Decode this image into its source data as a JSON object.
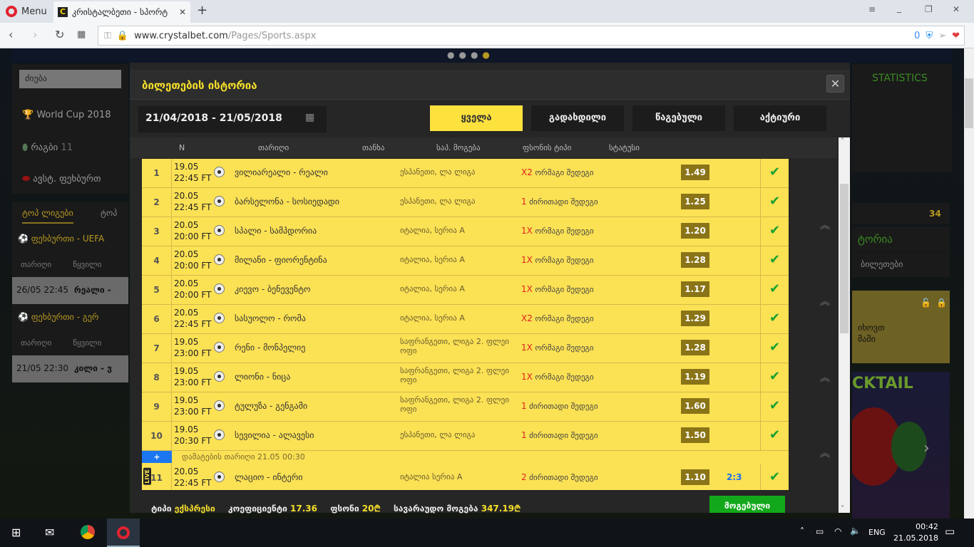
{
  "browser": {
    "menu": "Menu",
    "tab_title": "კრისტალბეთი - სპორტ",
    "new_tab": "+",
    "url_domain": "www.crystalbet.com",
    "url_path": "/Pages/Sports.aspx",
    "blocked_count": "0"
  },
  "background": {
    "search_placeholder": "ძიება",
    "sports": [
      {
        "label": "World Cup 2018",
        "count": ""
      },
      {
        "label": "რაგბი",
        "count": "11"
      },
      {
        "label": "ავსტ. ფეხბურთ",
        "count": ""
      }
    ],
    "tabs": [
      "ტოპ ლიგები",
      "ტოპ"
    ],
    "leagues": [
      {
        "title": "ფეხბურთი - UEFA",
        "col_date": "თარიღი",
        "col_match": "წყვილი",
        "date": "26/05 22:45",
        "match": "რეალი - "
      },
      {
        "title": "ფეხბურთი - გერ",
        "col_date": "თარიღი",
        "col_match": "წყვილი",
        "date": "21/05 22:30",
        "match": "კილი - ვ"
      }
    ],
    "statistics": "STATISTICS",
    "count": "34",
    "history": "ტორია",
    "tickets": "ბილეთები",
    "promo": [
      "იხოვთ",
      "მაში"
    ],
    "banner": "CKTAIL"
  },
  "modal": {
    "title": "ბილეთების ისტორია",
    "close": "✕",
    "date_range": "21/04/2018 - 21/05/2018",
    "filters": [
      "ყველა",
      "გადახდილი",
      "წაგებული",
      "აქტიური"
    ],
    "columns": [
      "N",
      "თარიღი",
      "თანხა",
      "საპ. მოგება",
      "ფსონის ტიპი",
      "სტატუსი"
    ],
    "rows": [
      {
        "n": "1",
        "date": "19.05",
        "time": "22:45 FT",
        "match": "ვილიარეალი - რეალი",
        "league": "ესპანეთი, ლა ლიგა",
        "pick": "X2",
        "bet": "ორმაგი შედეგი",
        "odds": "1.49",
        "score": "",
        "status": "✔"
      },
      {
        "n": "2",
        "date": "20.05",
        "time": "22:45 FT",
        "match": "ბარსელონა - სოსიედადი",
        "league": "ესპანეთი, ლა ლიგა",
        "pick": "1",
        "bet": "ძირითადი შედეგი",
        "odds": "1.25",
        "score": "",
        "status": "✔"
      },
      {
        "n": "3",
        "date": "20.05",
        "time": "20:00 FT",
        "match": "სპალი - სამპდორია",
        "league": "იტალია, სერია A",
        "pick": "1X",
        "bet": "ორმაგი შედეგი",
        "odds": "1.20",
        "score": "",
        "status": "✔"
      },
      {
        "n": "4",
        "date": "20.05",
        "time": "20:00 FT",
        "match": "მილანი - ფიორენტინა",
        "league": "იტალია, სერია A",
        "pick": "1X",
        "bet": "ორმაგი შედეგი",
        "odds": "1.28",
        "score": "",
        "status": "✔"
      },
      {
        "n": "5",
        "date": "20.05",
        "time": "20:00 FT",
        "match": "კიევო - ბენევენტო",
        "league": "იტალია, სერია A",
        "pick": "1X",
        "bet": "ორმაგი შედეგი",
        "odds": "1.17",
        "score": "",
        "status": "✔"
      },
      {
        "n": "6",
        "date": "20.05",
        "time": "22:45 FT",
        "match": "სასუოლო - რომა",
        "league": "იტალია, სერია A",
        "pick": "X2",
        "bet": "ორმაგი შედეგი",
        "odds": "1.29",
        "score": "",
        "status": "✔"
      },
      {
        "n": "7",
        "date": "19.05",
        "time": "23:00 FT",
        "match": "რენი - მონპელიე",
        "league": "საფრანგეთი, ლიგა 2. ფლეი ოფი",
        "pick": "1X",
        "bet": "ორმაგი შედეგი",
        "odds": "1.28",
        "score": "",
        "status": "✔"
      },
      {
        "n": "8",
        "date": "19.05",
        "time": "23:00 FT",
        "match": "ლიონი - ნიცა",
        "league": "საფრანგეთი, ლიგა 2. ფლეი ოფი",
        "pick": "1X",
        "bet": "ორმაგი შედეგი",
        "odds": "1.19",
        "score": "",
        "status": "✔"
      },
      {
        "n": "9",
        "date": "19.05",
        "time": "23:00 FT",
        "match": "ტულუზა - გენგამი",
        "league": "საფრანგეთი, ლიგა 2. ფლეი ოფი",
        "pick": "1",
        "bet": "ძირითადი შედეგი",
        "odds": "1.60",
        "score": "",
        "status": "✔"
      },
      {
        "n": "10",
        "date": "19.05",
        "time": "20:30 FT",
        "match": "სევილია - ალავესი",
        "league": "ესპანეთი, ლა ლიგა",
        "pick": "1",
        "bet": "ძირითადი შედეგი",
        "odds": "1.50",
        "score": "",
        "status": "✔"
      },
      {
        "n": "11",
        "date": "20.05",
        "time": "22:45 FT",
        "match": "ლაციო - ინტერი",
        "league": "იტალია სერია A",
        "pick": "2",
        "bet": "ძირითადი შედეგი",
        "odds": "1.10",
        "score": "2:3",
        "status": "✔",
        "live": "LIVE",
        "added": "დამატების თარიღი 21.05 00:30"
      }
    ],
    "footer": {
      "type_label": "ტიპი",
      "type": "ექსპრესი",
      "coef_label": "კოეფიციენტი",
      "coef": "17.36",
      "stake_label": "ფსონი",
      "stake": "20₾",
      "win_label": "სავარაუდო მოგება",
      "win": "347.19₾",
      "result": "მოგებული"
    }
  },
  "taskbar": {
    "lang": "ENG",
    "time": "00:42",
    "date": "21.05.2018"
  }
}
